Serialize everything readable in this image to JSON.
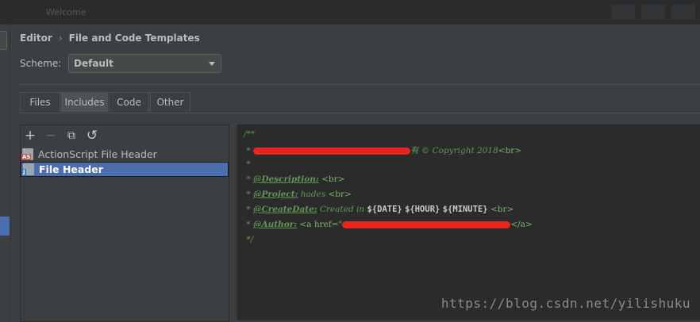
{
  "window": {
    "blurred_title": "Welcome"
  },
  "breadcrumb": {
    "root": "Editor",
    "separator": "›",
    "current": "File and Code Templates"
  },
  "scheme": {
    "label": "Scheme:",
    "value": "Default"
  },
  "tabs": [
    {
      "label": "Files",
      "active": false
    },
    {
      "label": "Includes",
      "active": true
    },
    {
      "label": "Code",
      "active": false
    },
    {
      "label": "Other",
      "active": false
    }
  ],
  "toolbar": {
    "add_icon": "+",
    "remove_icon": "−",
    "copy_icon": "⧉",
    "reset_icon": "↺"
  },
  "templates": [
    {
      "label": "ActionScript File Header",
      "icon_badge": "AS",
      "selected": false
    },
    {
      "label": "File Header",
      "icon_badge": "J",
      "selected": true
    }
  ],
  "editor": {
    "line1": "/**",
    "line2_prefix": " * ",
    "line2_suffix": "有 © Copyright 2018",
    "line2_tag": "<br>",
    "line3": " *",
    "desc_prefix": " * ",
    "desc_tag": "@Description:",
    "desc_br": " <br>",
    "proj_prefix": " * ",
    "proj_tag": "@Project:",
    "proj_value": " hades ",
    "proj_br": "<br>",
    "date_prefix": " * ",
    "date_tag": "@CreateDate:",
    "date_text": " Created in ",
    "date_var1": "${DATE}",
    "date_var2": "${HOUR}",
    "date_var3": "${MINUTE}",
    "date_br": " <br>",
    "author_prefix": " * ",
    "author_tag": "@Author:",
    "author_link_open": " <a href=\"",
    "author_link_close": "</a>",
    "line_end": " */"
  },
  "watermark": "https://blog.csdn.net/yilishuku"
}
